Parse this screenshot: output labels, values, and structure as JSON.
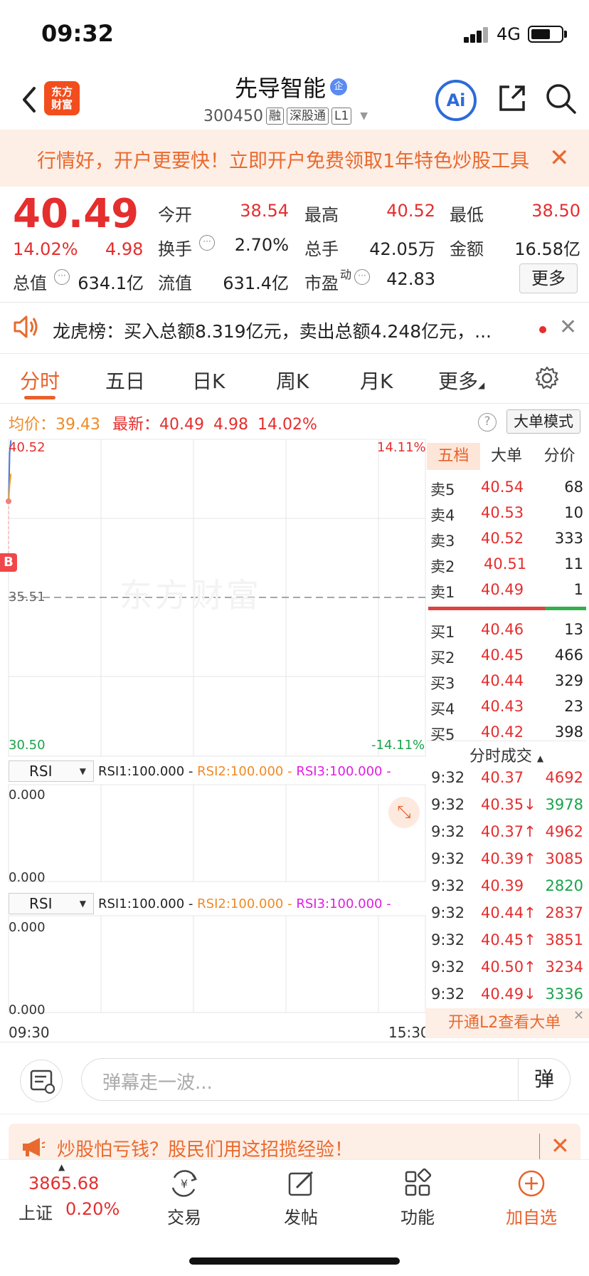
{
  "status_bar": {
    "time": "09:32",
    "network": "4G"
  },
  "header": {
    "logo_line1": "东方",
    "logo_line2": "财富",
    "stock_name": "先导智能",
    "name_badge": "企",
    "stock_code": "300450",
    "tags": [
      "融",
      "深股通",
      "L1"
    ],
    "ai_label": "Ai"
  },
  "promo": {
    "text": "行情好，开户更要快！立即开户免费领取1年特色炒股工具",
    "close": "✕"
  },
  "quote": {
    "price": "40.49",
    "change_pct": "14.02%",
    "change": "4.98",
    "fields": [
      {
        "label": "今开",
        "value": "38.54",
        "color": "red"
      },
      {
        "label": "最高",
        "value": "40.52",
        "color": "red"
      },
      {
        "label": "最低",
        "value": "38.50",
        "color": "red"
      },
      {
        "label": "换手",
        "value": "2.70%",
        "color": "black"
      },
      {
        "label": "总手",
        "value": "42.05万",
        "color": "black"
      },
      {
        "label": "金额",
        "value": "16.58亿",
        "color": "black"
      },
      {
        "label": "总值",
        "value": "634.1亿",
        "color": "black"
      },
      {
        "label": "流值",
        "value": "631.4亿",
        "color": "black"
      },
      {
        "label": "市盈",
        "value": "42.83",
        "color": "black"
      }
    ],
    "pe_super": "动",
    "more_label": "更多"
  },
  "dragon_tiger": {
    "text": "龙虎榜：买入总额8.319亿元，卖出总额4.248亿元，..."
  },
  "tabs": [
    "分时",
    "五日",
    "日K",
    "周K",
    "月K",
    "更多"
  ],
  "summary": {
    "avg_label": "均价：",
    "avg_value": "39.43",
    "latest_label": "最新：",
    "latest_value": "40.49",
    "latest_change": "4.98",
    "latest_pct": "14.02%",
    "help": "?",
    "big_order_mode": "大单模式"
  },
  "chart": {
    "top_price": "40.52",
    "top_pct": "14.11%",
    "mid_price": "35.51",
    "bottom_price": "30.50",
    "bottom_pct": "-14.11%",
    "b_marker": "B",
    "watermark": "东方财富",
    "time_start": "09:30",
    "time_end": "15:30"
  },
  "chart_data": {
    "type": "line",
    "x": [
      "09:30",
      "09:31",
      "09:32"
    ],
    "series": [
      {
        "values": [
          38.54,
          40.1,
          40.49
        ],
        "color": "#4a78d8"
      },
      {
        "values": [
          38.54,
          39.1,
          39.43
        ],
        "color": "#f0a020"
      }
    ],
    "ylim": [
      30.5,
      40.52
    ],
    "xlim": [
      "09:30",
      "15:30"
    ],
    "reference": 35.51,
    "grid": true
  },
  "rsi_panels": [
    {
      "select": "RSI",
      "rsi1": "RSI1:100.000 -",
      "rsi2": "RSI2:100.000 -",
      "rsi3": "RSI3:100.000 -",
      "top": "0.000",
      "bottom": "0.000"
    },
    {
      "select": "RSI",
      "rsi1": "RSI1:100.000 -",
      "rsi2": "RSI2:100.000 -",
      "rsi3": "RSI3:100.000 -",
      "top": "0.000",
      "bottom": "0.000"
    }
  ],
  "order_book": {
    "tabs": [
      "五档",
      "大单",
      "分价"
    ],
    "asks": [
      {
        "label": "卖5",
        "price": "40.54",
        "vol": "68"
      },
      {
        "label": "卖4",
        "price": "40.53",
        "vol": "10"
      },
      {
        "label": "卖3",
        "price": "40.52",
        "vol": "333"
      },
      {
        "label": "卖2",
        "price": "40.51",
        "vol": "11"
      },
      {
        "label": "卖1",
        "price": "40.49",
        "vol": "1"
      }
    ],
    "bids": [
      {
        "label": "买1",
        "price": "40.46",
        "vol": "13"
      },
      {
        "label": "买2",
        "price": "40.45",
        "vol": "466"
      },
      {
        "label": "买3",
        "price": "40.44",
        "vol": "329"
      },
      {
        "label": "买4",
        "price": "40.43",
        "vol": "23"
      },
      {
        "label": "买5",
        "price": "40.42",
        "vol": "398"
      }
    ],
    "buy_ratio": 0.74
  },
  "ticks": {
    "header": "分时成交",
    "rows": [
      {
        "time": "9:32",
        "price": "40.37",
        "vol": "4692",
        "dir": ""
      },
      {
        "time": "9:32",
        "price": "40.35↓",
        "vol": "3978",
        "dir": "down"
      },
      {
        "time": "9:32",
        "price": "40.37↑",
        "vol": "4962",
        "dir": "up"
      },
      {
        "time": "9:32",
        "price": "40.39↑",
        "vol": "3085",
        "dir": "up"
      },
      {
        "time": "9:32",
        "price": "40.39",
        "vol": "2820",
        "dir": "flat"
      },
      {
        "time": "9:32",
        "price": "40.44↑",
        "vol": "2837",
        "dir": "up"
      },
      {
        "time": "9:32",
        "price": "40.45↑",
        "vol": "3851",
        "dir": "up"
      },
      {
        "time": "9:32",
        "price": "40.50↑",
        "vol": "3234",
        "dir": "up"
      },
      {
        "time": "9:32",
        "price": "40.49↓",
        "vol": "3336",
        "dir": "down"
      }
    ],
    "l2_banner": "开通L2查看大单"
  },
  "comment": {
    "placeholder": "弹幕走一波...",
    "dan_label": "弹"
  },
  "tip": {
    "text": "炒股怕亏钱？股民们用这招揽经验！"
  },
  "bottom_nav": {
    "index_value": "3865.68",
    "index_name": "上证",
    "index_pct": "0.20%",
    "items": [
      "交易",
      "发帖",
      "功能",
      "加自选"
    ]
  },
  "colors": {
    "up": "#e52e2e",
    "down": "#1aa34a",
    "accent": "#e8612c",
    "avg_line": "#f0a020",
    "price_line": "#4a78d8"
  }
}
